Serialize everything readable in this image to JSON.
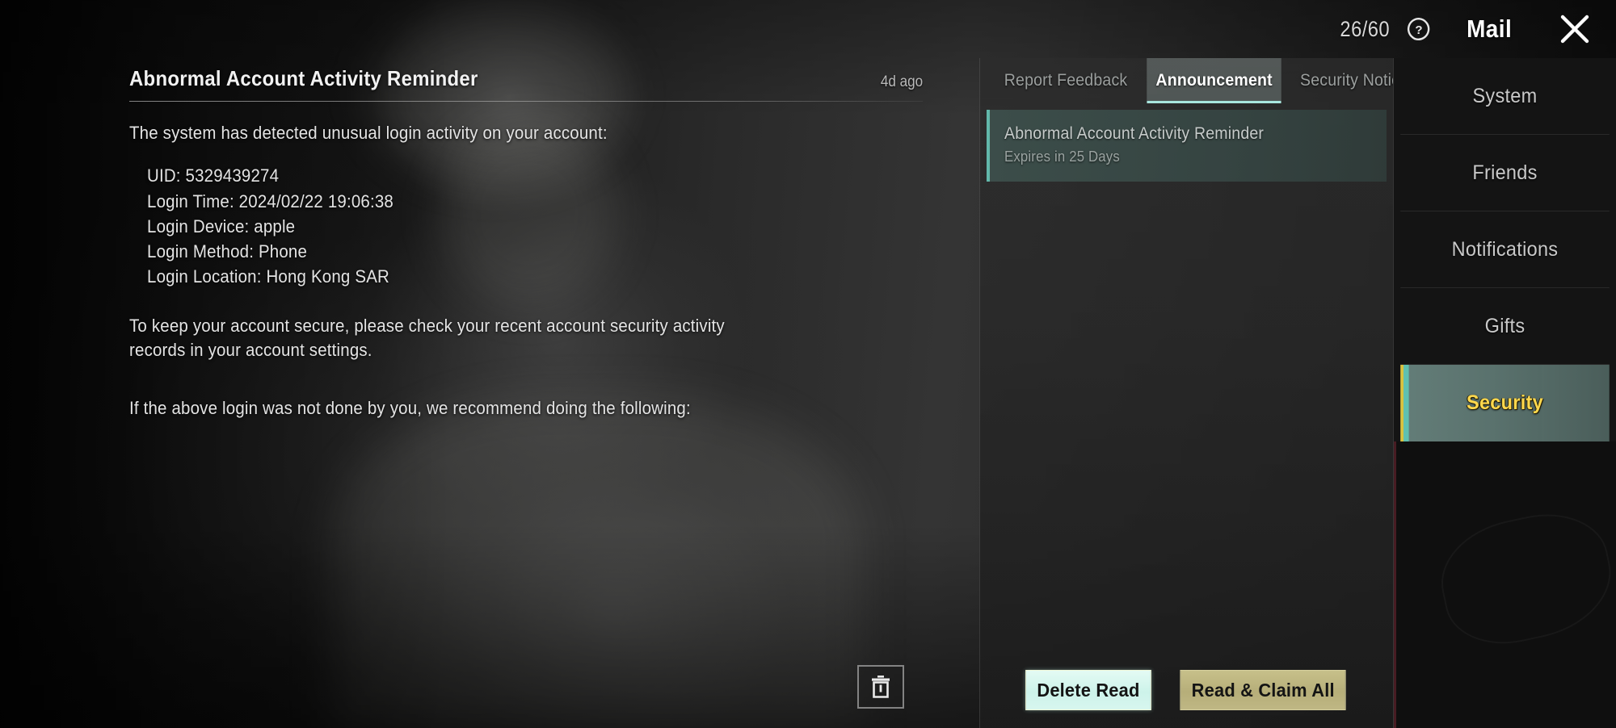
{
  "header": {
    "counter": "26/60",
    "help_icon": "help-circle-icon",
    "title": "Mail",
    "close_icon": "close-icon"
  },
  "mail_detail": {
    "title": "Abnormal Account Activity Reminder",
    "time_ago": "4d ago",
    "intro": "The system has detected unusual login activity on your account:",
    "details": [
      "UID: 5329439274",
      "Login Time: 2024/02/22 19:06:38",
      "Login Device: apple",
      "Login Method: Phone",
      "Login Location: Hong Kong SAR"
    ],
    "paragraph_2": "To keep your account secure, please check your recent account security activity records in your account settings.",
    "paragraph_3": "If the above login was not done by you, we recommend doing the following:",
    "delete_icon": "trash-icon"
  },
  "list_panel": {
    "tabs": [
      {
        "label": "Report Feedback",
        "active": false
      },
      {
        "label": "Announcement",
        "active": true
      },
      {
        "label": "Security Notice",
        "active": false
      }
    ],
    "items": [
      {
        "title": "Abnormal Account Activity Reminder",
        "expiry": "Expires in 25 Days",
        "selected": true
      }
    ],
    "actions": {
      "delete_read": "Delete Read",
      "read_claim_all": "Read & Claim All"
    }
  },
  "sidebar": {
    "items": [
      {
        "label": "System",
        "active": false
      },
      {
        "label": "Friends",
        "active": false
      },
      {
        "label": "Notifications",
        "active": false
      },
      {
        "label": "Gifts",
        "active": false
      },
      {
        "label": "Security",
        "active": true
      }
    ]
  },
  "colors": {
    "accent_teal": "#62b8ab",
    "accent_yellow": "#ffd84d",
    "button_mint": "#cdf3ea",
    "button_khaki": "#b6ae79",
    "panel_bg": "#2a2a2a",
    "sidebar_bg": "#141414"
  }
}
